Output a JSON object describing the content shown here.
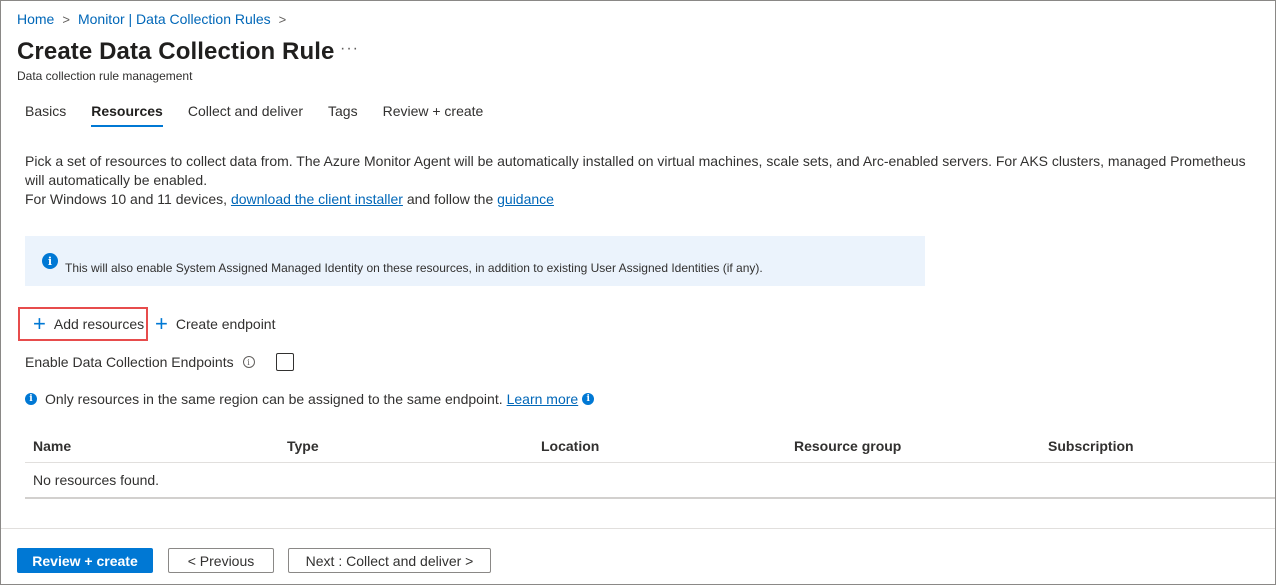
{
  "breadcrumb": {
    "home": "Home",
    "monitor": "Monitor | Data Collection Rules",
    "separator": ">"
  },
  "page": {
    "title": "Create Data Collection Rule",
    "more": "···",
    "subtitle": "Data collection rule management"
  },
  "tabs": [
    {
      "label": "Basics",
      "active": false
    },
    {
      "label": "Resources",
      "active": true
    },
    {
      "label": "Collect and deliver",
      "active": false
    },
    {
      "label": "Tags",
      "active": false
    },
    {
      "label": "Review + create",
      "active": false
    }
  ],
  "description": {
    "line1": "Pick a set of resources to collect data from. The Azure Monitor Agent will be automatically installed on virtual machines, scale sets, and Arc-enabled servers. For AKS clusters, managed Prometheus will automatically be enabled.",
    "line2_prefix": "For Windows 10 and 11 devices, ",
    "line2_link1": "download the client installer",
    "line2_mid": " and follow the ",
    "line2_link2": "guidance"
  },
  "info_banner": {
    "text": "This will also enable System Assigned Managed Identity on these resources, in addition to existing User Assigned Identities (if any).",
    "icon": "info-icon"
  },
  "commands": {
    "add_resources": "Add resources",
    "create_endpoint": "Create endpoint"
  },
  "dce": {
    "label": "Enable Data Collection Endpoints",
    "checked": false
  },
  "note": {
    "text": "Only resources in the same region can be assigned to the same endpoint.",
    "link": "Learn more"
  },
  "table": {
    "columns": [
      "Name",
      "Type",
      "Location",
      "Resource group",
      "Subscription"
    ],
    "empty_text": "No resources found."
  },
  "footer": {
    "review_create": "Review + create",
    "previous": "< Previous",
    "next": "Next : Collect and deliver >"
  },
  "colors": {
    "accent": "#0078d4",
    "link": "#0067b8",
    "highlight_border": "#e74c4c",
    "banner_bg": "#ebf3fc"
  }
}
